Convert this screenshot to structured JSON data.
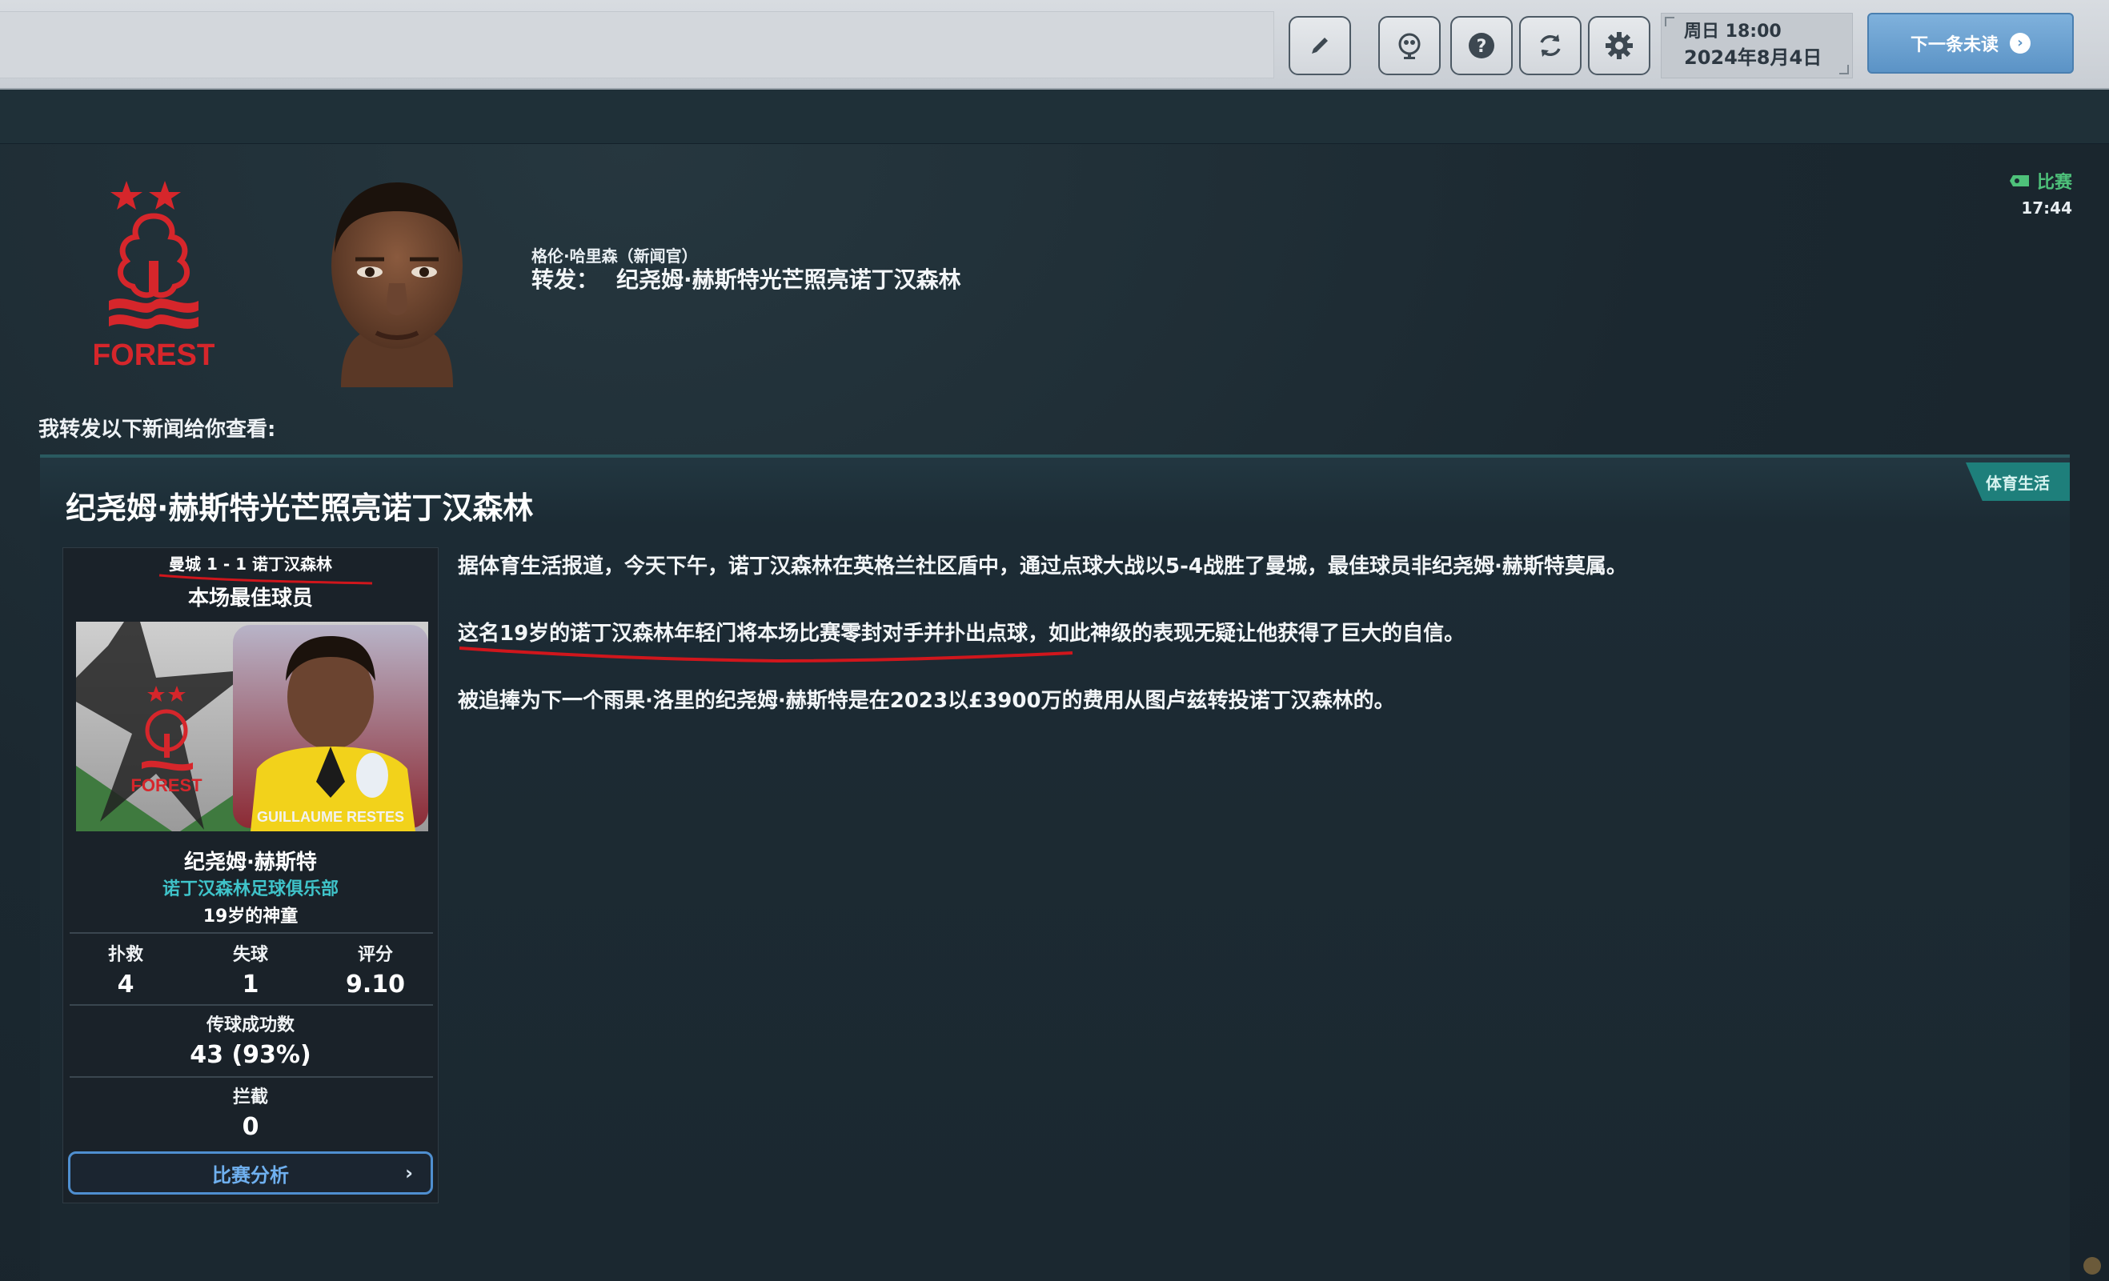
{
  "toolbar": {
    "buttons": [
      "edit",
      "chat",
      "help",
      "refresh",
      "settings"
    ],
    "date_line1": "周日 18:00",
    "date_line2": "2024年8月4日",
    "next_unread": "下一条未读"
  },
  "message": {
    "sender": "格伦·哈里森（新闻官）",
    "subject_prefix": "转发：",
    "subject": "纪尧姆·赫斯特光芒照亮诺丁汉森林",
    "tag": "比赛",
    "time": "17:44",
    "forward_note": "我转发以下新闻给你查看:"
  },
  "club_logo_text": "FOREST",
  "news": {
    "source_tag": "体育生活",
    "title": "纪尧姆·赫斯特光芒照亮诺丁汉森林",
    "paragraphs": [
      "据体育生活报道，今天下午，诺丁汉森林在英格兰社区盾中，通过点球大战以5-4战胜了曼城，最佳球员非纪尧姆·赫斯特莫属。",
      "这名19岁的诺丁汉森林年轻门将本场比赛零封对手并扑出点球，如此神级的表现无疑让他获得了巨大的自信。",
      "被追捧为下一个雨果·洛里的纪尧姆·赫斯特是在2023以£3900万的费用从图卢兹转投诺丁汉森林的。"
    ]
  },
  "potm": {
    "score": "曼城 1 - 1 诺丁汉森林",
    "label": "本场最佳球员",
    "photo_caption": "GUILLAUME RESTES",
    "player_name": "纪尧姆·赫斯特",
    "club": "诺丁汉森林足球俱乐部",
    "description": "19岁的神童",
    "stats": {
      "saves_label": "扑救",
      "saves": "4",
      "conceded_label": "失球",
      "conceded": "1",
      "rating_label": "评分",
      "rating": "9.10",
      "passes_label": "传球成功数",
      "passes": "43 (93%)",
      "interceptions_label": "拦截",
      "interceptions": "0"
    },
    "analysis_button": "比赛分析"
  },
  "colors": {
    "accent_teal": "#3fc3c9",
    "tag_green": "#4ec17a",
    "underline_red": "#d0161c",
    "forest_red": "#d6262b"
  }
}
